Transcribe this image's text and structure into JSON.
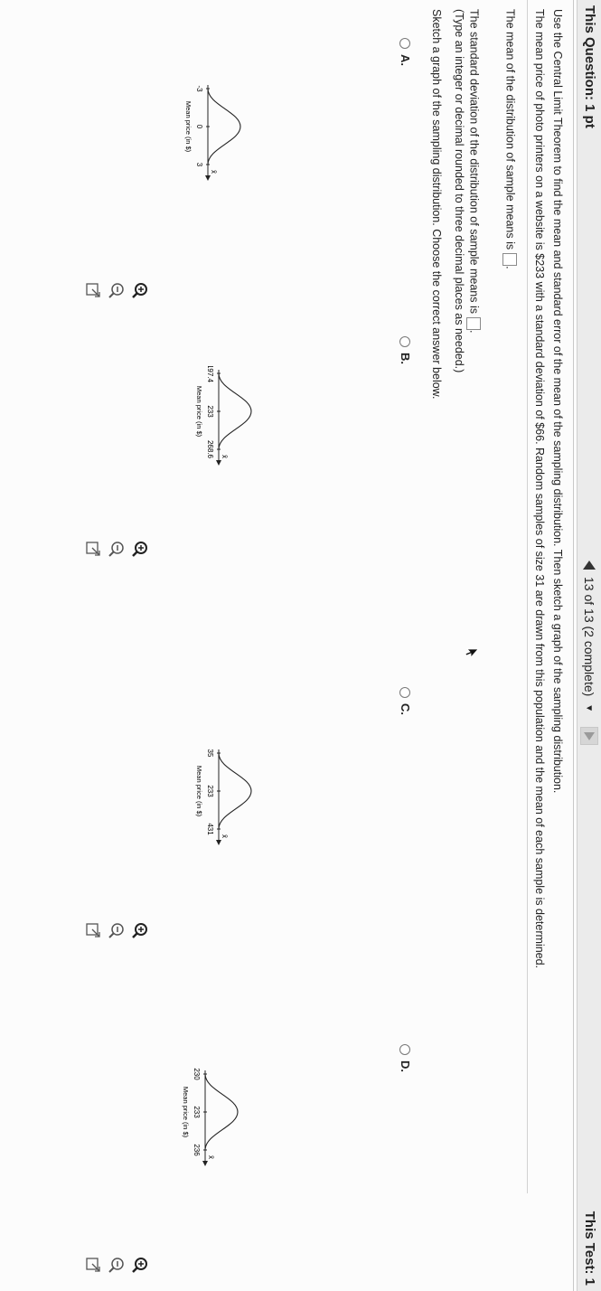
{
  "header": {
    "question_label": "This Question: 1 pt",
    "progress": "13 of 13 (2 complete)",
    "test_label": "This Test: 1"
  },
  "question": {
    "intro": "Use the Central Limit Theorem to find the mean and standard error of the mean of the sampling distribution. Then sketch a graph of the sampling distribution.",
    "given": "The mean price of photo printers on a website is $233 with a standard deviation of $66. Random samples of size 31 are drawn from this population and the mean of each sample is determined.",
    "mean_prompt": "The mean of the distribution of sample means is",
    "sd_prompt": "The standard deviation of the distribution of sample means is",
    "sd_note": "(Type an integer or decimal rounded to three decimal places as needed.)",
    "sketch_prompt": "Sketch a graph of the sampling distribution. Choose the correct answer below."
  },
  "options": [
    {
      "letter": "A.",
      "ticks": [
        "-3",
        "0",
        "3"
      ],
      "axis_label": "Mean price (in $)",
      "x_symbol": "x̄"
    },
    {
      "letter": "B.",
      "ticks": [
        "197.4",
        "233",
        "268.6"
      ],
      "axis_label": "Mean price (in $)",
      "x_symbol": "x̄"
    },
    {
      "letter": "C.",
      "ticks": [
        "35",
        "233",
        "431"
      ],
      "axis_label": "Mean price (in $)",
      "x_symbol": "x̄"
    },
    {
      "letter": "D.",
      "ticks": [
        "230",
        "233",
        "236"
      ],
      "axis_label": "Mean price (in $)",
      "x_symbol": "x̄"
    }
  ],
  "icons": [
    "zoom-in-icon",
    "zoom-out-icon",
    "popout-icon",
    "radio-button-icon",
    "prev-arrow-icon",
    "next-arrow-icon",
    "dropdown-arrow-icon"
  ]
}
